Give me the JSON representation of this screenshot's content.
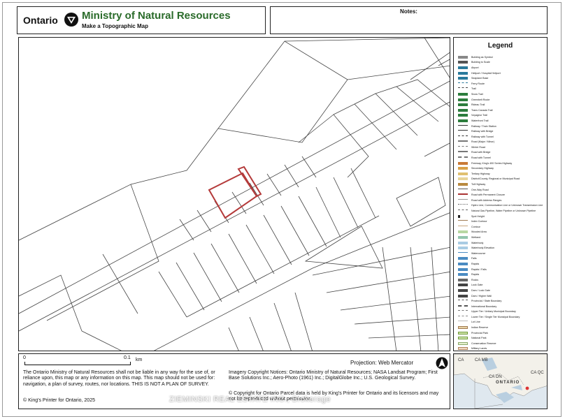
{
  "header": {
    "brand": "Ontario",
    "ministry": "Ministry of Natural Resources",
    "subtitle": "Make a Topographic Map"
  },
  "notes": {
    "label": "Notes:"
  },
  "legend": {
    "title": "Legend",
    "items": [
      "Building as Symbol",
      "Building to Scale",
      "Airport",
      "Heliport / Hospital Heliport",
      "Seaplane Base",
      "Ferry Route",
      "Trail",
      "Snow Trail",
      "Greenbelt Route",
      "Rideau Trail",
      "Trans Canada Trail",
      "Voyageur Trail",
      "Waterfront Trail",
      "Railway / Train Station",
      "Railway with Bridge",
      "Railway with Tunnel",
      "Road (Major / Minor)",
      "Winter Road",
      "Road with Bridge",
      "Road with Tunnel",
      "Freeway, King's 400 Series Highway",
      "Secondary Highway",
      "Tertiary Highway",
      "District/County, Regional or Municipal Road",
      "Toll Highway",
      "One-Way Road",
      "Road with Permanent Closure",
      "Road with Address Ranges",
      "Hydro Line, Communication Line or Unknown Transmission Line",
      "Natural Gas Pipeline, Water Pipeline or Unknown Pipeline",
      "Spot Height",
      "Index Contour",
      "Contour",
      "Wooded Area",
      "Wetland",
      "Waterbody",
      "Waterbody Elevation",
      "Watercourse",
      "Falls",
      "Rapids",
      "Rapids / Falls",
      "Rapids",
      "Rocks",
      "Lock Gate",
      "Dam / Lock Gate",
      "Dam / Higher Wall",
      "Provincial / State Boundary",
      "International Boundary",
      "Upper Tier / Unitary Municipal Boundary",
      "Lower Tier / Single Tier Municipal Boundary",
      "Lot Line",
      "Indian Reserve",
      "Provincial Park",
      "National Park",
      "Conservation Reserve",
      "Military Lands"
    ]
  },
  "scale": {
    "zero": "0",
    "value": "0.1",
    "unit": "km"
  },
  "projection": "Projection: Web Mercator",
  "disclaimer": "The Ontario Ministry of Natural Resources shall not be liable in any way for the use of, or reliance upon, this map or any information on this map.  This map should not be used for: navigation, a plan of survey, routes, nor locations. THIS IS NOT A PLAN OF SURVEY.",
  "imagery": "Imagery Copyright Notices: Ontario Ministry of Natural Resources; NASA Landsat Program; First Base Solutions Inc.; Aero-Photo (1961) Inc.; DigitalGlobe Inc.; U.S. Geological Survey.",
  "parcel_copyright": "© Copyright for Ontario Parcel data is held by King's Printer for Ontario and its licensors and may not be reproduced without permission.",
  "copyright": "© King's Printer for Ontario,  2025",
  "watermark": "ZIEMINSKI REAL ESTATE INC., Brokerage",
  "minimap": {
    "labels": [
      "CA",
      "CA MB",
      "CA ON",
      "CA QC",
      "ONTARIO"
    ]
  },
  "colors": {
    "ministry_green": "#2a6b2a",
    "parcel_red": "#b43a3a"
  }
}
